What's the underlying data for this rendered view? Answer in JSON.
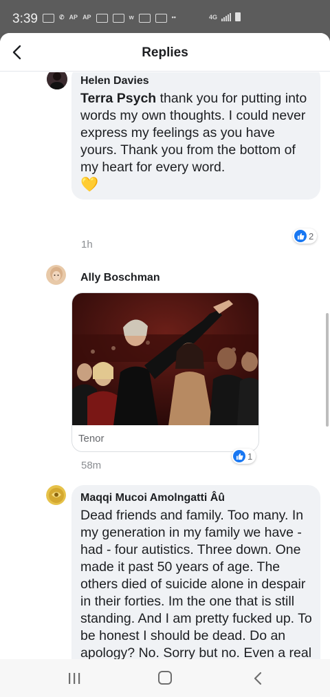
{
  "status_bar": {
    "time": "3:39",
    "icons": [
      "gallery-icon",
      "missed-call-icon",
      "ap-news-icon",
      "ap-news-icon",
      "photo-icon",
      "message-icon",
      "w-app-icon",
      "image-icon",
      "calendar-icon",
      "more-dots-icon"
    ],
    "ap_label": "AP",
    "network": "4G",
    "colors": {
      "bar": "#5c5c5c"
    }
  },
  "header": {
    "title": "Replies",
    "back_icon": "chevron-left-icon"
  },
  "comments": [
    {
      "author": "Helen Davies",
      "mention": "Terra Psych",
      "text": " thank you for putting into words my own thoughts. I could never express my feelings as you have yours. Thank you from the bottom of my heart for every word.",
      "emoji": "💛",
      "time": "1h",
      "reaction_count": "2",
      "reaction_icon": "like-icon"
    },
    {
      "author": "Ally Boschman",
      "attachment_source": "Tenor",
      "time": "58m",
      "reaction_count": "1",
      "reaction_icon": "like-icon"
    },
    {
      "author": "Maqqi Mucoi Amolngatti Âû",
      "text": "Dead friends and family. Too many. In my generation in my family we have - had - four autistics. Three down. One made it past 50 years of age. The others died of suicide alone in despair in their forties. Im the one that is still standing. And I am pretty fucked up. To be honest I should be dead. Do an apology? No. Sorry but no. Even a real one won't cut it."
    }
  ],
  "nav_bar": {
    "icons": [
      "recent-apps-icon",
      "home-icon",
      "back-icon"
    ]
  },
  "colors": {
    "accent": "#1877f2",
    "bubble": "#f0f2f5",
    "muted_text": "#8a8d91"
  }
}
